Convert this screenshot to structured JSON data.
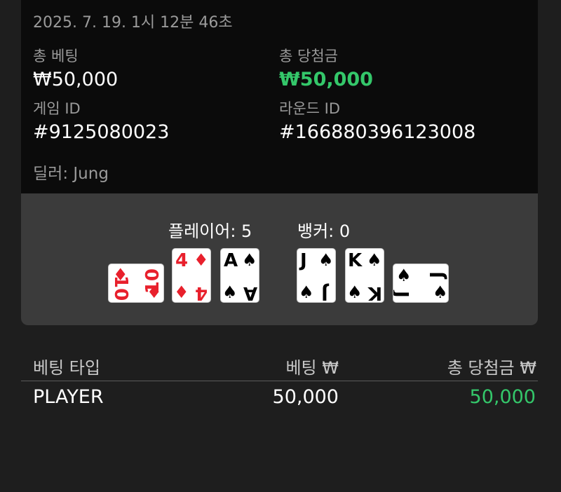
{
  "round": {
    "timestamp": "2025. 7. 19. 1시 12분 46초",
    "total_bet_label": "총 베팅",
    "total_bet_value": "₩50,000",
    "total_win_label": "총 당첨금",
    "total_win_value": "₩50,000",
    "game_id_label": "게임 ID",
    "game_id_value": "#9125080023",
    "round_id_label": "라운드 ID",
    "round_id_value": "#166880396123008",
    "dealer": "딜러: Jung"
  },
  "hands": {
    "player_score": "플레이어: 5",
    "banker_score": "뱅커: 0",
    "player_cards": [
      {
        "rank": "10",
        "suit": "♦",
        "color": "#e8202c"
      },
      {
        "rank": "4",
        "suit": "♦",
        "color": "#e8202c"
      },
      {
        "rank": "A",
        "suit": "♠",
        "color": "#000000"
      }
    ],
    "banker_cards": [
      {
        "rank": "J",
        "suit": "♠",
        "color": "#000000"
      },
      {
        "rank": "K",
        "suit": "♠",
        "color": "#000000"
      },
      {
        "rank": "J",
        "suit": "♠",
        "color": "#000000"
      }
    ]
  },
  "bets_table": {
    "headers": [
      "베팅 타입",
      "베팅 ₩",
      "총 당첨금 ₩"
    ],
    "rows": [
      {
        "type": "PLAYER",
        "bet": "50,000",
        "win": "50,000"
      }
    ]
  },
  "colors": {
    "win_green": "#34c76a",
    "panel_dark": "#0b0b0b",
    "panel_gray": "#3b3b3b",
    "background": "#1e1e1e"
  }
}
